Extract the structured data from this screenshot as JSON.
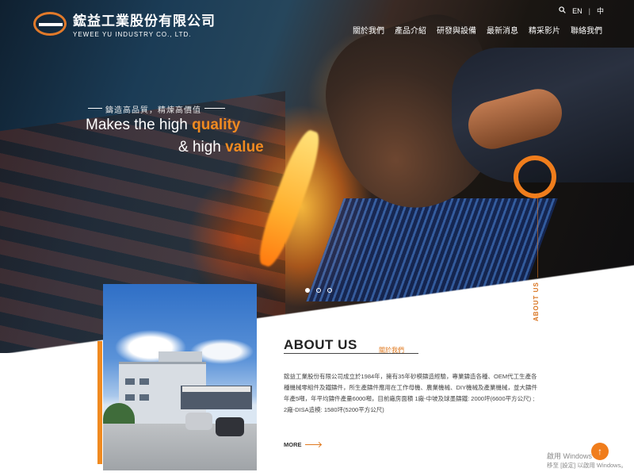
{
  "header": {
    "logo_cn": "鋐益工業股份有限公司",
    "logo_en": "YEWEE YU INDUSTRY CO., LTD.",
    "lang_en": "EN",
    "lang_sep": "|",
    "lang_cn": "中"
  },
  "nav": [
    {
      "label": "關於我們"
    },
    {
      "label": "產品介紹"
    },
    {
      "label": "研發與設備"
    },
    {
      "label": "最新消息"
    },
    {
      "label": "精采影片"
    },
    {
      "label": "聯絡我們"
    }
  ],
  "hero": {
    "tagline_cn": "鑄造高品質，精煉高價值",
    "slogan_line1_prefix": "Makes the high ",
    "slogan_line1_accent": "quality",
    "slogan_line2_prefix": "& high ",
    "slogan_line2_accent": "value",
    "side_label": "ABOUT US",
    "slide_count": 3,
    "active_slide": 1
  },
  "about": {
    "title": "ABOUT US",
    "subtitle_cn": "關於我們",
    "body": "鋐益工業股份有限公司成立於1984年，擁有35年砂模鑄造經驗，專業鑄造各種、OEM代工生產各種機械零組件及鐵鑄件，所生產鑄件應用在工作母機、農業機械、DIY機械及產業機械，並大鑄件年產5噸，年平均鑄件產量6000噸，目前廠房面積 1廠-中坡及球墨鑄鐵: 2000坪(6600平方公尺) ; 2廠-DISA造模: 1580坪(5200平方公尺)",
    "more_label": "MORE"
  },
  "misc": {
    "to_top_symbol": "↑",
    "watermark_line1": "啟用 Windows",
    "watermark_line2": "移至 [設定] 以啟用 Windows。"
  },
  "colors": {
    "accent": "#f08a20",
    "nav_text": "#ffffff"
  }
}
